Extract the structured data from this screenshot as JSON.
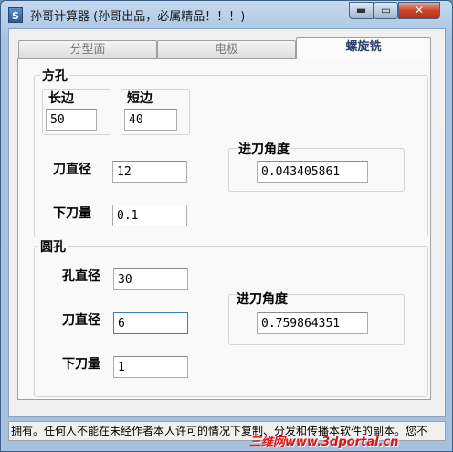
{
  "window": {
    "title": "孙哥计算器 (孙哥出品，必属精品！！！)",
    "icon": "S"
  },
  "controls": {
    "minimize": "▬",
    "maximize": "▭",
    "close": "✕"
  },
  "tabs": [
    {
      "label": "分型面",
      "active": false
    },
    {
      "label": "电极",
      "active": false
    },
    {
      "label": "螺旋铣",
      "active": true
    }
  ],
  "square": {
    "legend": "方孔",
    "long_label": "长边",
    "long_value": "50",
    "short_label": "短边",
    "short_value": "40",
    "tool_label": "刀直径",
    "tool_value": "12",
    "step_label": "下刀量",
    "step_value": "0.1",
    "angle_label": "进刀角度",
    "angle_value": "0.043405861"
  },
  "round": {
    "legend": "圆孔",
    "hole_label": "孔直径",
    "hole_value": "30",
    "tool_label": "刀直径",
    "tool_value": "6",
    "step_label": "下刀量",
    "step_value": "1",
    "angle_label": "进刀角度",
    "angle_value": "0.759864351"
  },
  "status_text": "拥有。任何人不能在未经作者本人许可的情况下复制、分发和传播本软件的副本。您不",
  "watermark": "三维网www.3dportal.cn"
}
